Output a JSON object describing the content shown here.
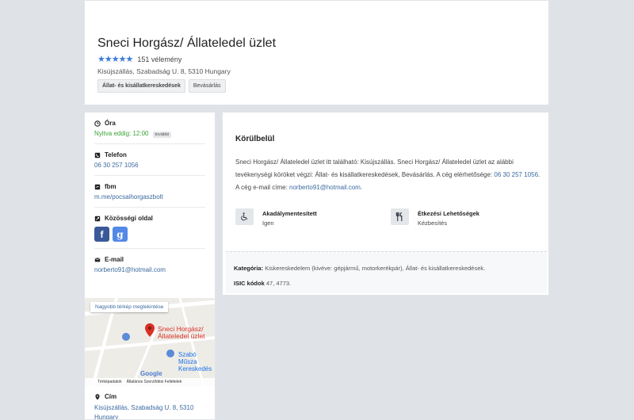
{
  "business": {
    "name": "Sneci Horgász/ Állateledel üzlet",
    "stars": "★★★★★",
    "review_count": "151 vélemény",
    "address_short": "Kisújszállás, Szabadság U. 8, 5310 Hungary",
    "tags": [
      "Állat- és kisállatkereskedések",
      "Bevásárlás"
    ]
  },
  "sidebar": {
    "hours": {
      "label": "Óra",
      "status": "Nyitva eddig: 12:00",
      "badge": "további"
    },
    "phone": {
      "label": "Telefon",
      "value": "06 30 257 1056"
    },
    "fbm": {
      "label": "fbm",
      "value": "m.me/pocsaihorgaszbolt"
    },
    "social": {
      "label": "Közösségi oldal",
      "fb_glyph": "f",
      "google_glyph": "g"
    },
    "email": {
      "label": "E-mail",
      "value": "norberto91@hotmail.com"
    },
    "address": {
      "label": "Cím",
      "line1": "Kisújszállás, Szabadság U. 8, 5310",
      "line2": "Hungary"
    }
  },
  "map": {
    "larger_map_button": "Nagyobb térkép megtekintése",
    "pin_label_1": "Sneci Horgász/",
    "pin_label_2": "Állateledel üzlet",
    "shop_label_1": "Szabó Műsza",
    "shop_label_2": "Kereskedés",
    "google": "Google",
    "footer_data": "Térképadatok",
    "footer_terms": "Általános Szerződési Feltételek",
    "street_1": "Szepes",
    "street_2": "utca"
  },
  "about": {
    "title": "Körülbelül",
    "desc_1": "Sneci Horgász/ Állateledel üzlet itt található: Kisújszállás. Sneci Horgász/ Állateledel üzlet az alábbi tevékenységi köröket végzi: Állat- és kisállatkereskedések, Bevásárlás. A cég elérhetősége: ",
    "desc_phone": "06 30 257 1056",
    "desc_2": ". A cég e-mail címe: ",
    "desc_email": "norberto91@hotmail.com",
    "desc_3": ".",
    "features": [
      {
        "title": "Akadálymentesített",
        "value": "Igen",
        "icon": "wheelchair-icon"
      },
      {
        "title": "Étkezési Lehetőségek",
        "value": "Kézbesítés",
        "icon": "cutlery-icon"
      }
    ],
    "category_label": "Kategória:",
    "category_value": "Kiskereskedelem (kivéve: gépjármű, motorkerékpár), Állat- és kisállatkereskedések.",
    "isic_label": "ISIC kódok",
    "isic_value": "47, 4773."
  },
  "colors": {
    "link": "#3b6aa0",
    "open": "#3aa335",
    "star": "#3e7bd6",
    "pin": "#d93025"
  }
}
